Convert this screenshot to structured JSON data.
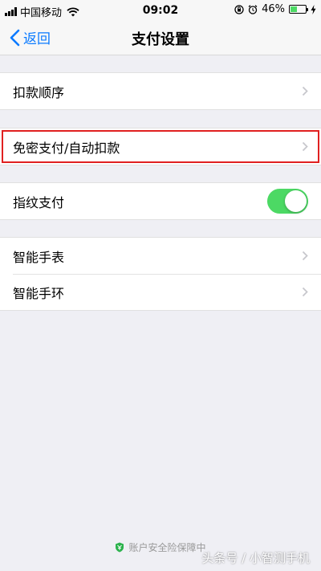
{
  "status_bar": {
    "carrier": "中国移动",
    "time": "09:02",
    "battery_percent_label": "46%",
    "battery_level": 0.46,
    "icons": [
      "signal-icon",
      "wifi-icon",
      "rotation-lock-icon",
      "alarm-icon",
      "battery-icon",
      "charging-icon"
    ]
  },
  "nav": {
    "back_label": "返回",
    "title": "支付设置"
  },
  "groups": [
    {
      "items": [
        {
          "label": "扣款顺序",
          "accessory": "chevron"
        }
      ]
    },
    {
      "items": [
        {
          "label": "免密支付/自动扣款",
          "accessory": "chevron",
          "highlighted": true
        }
      ]
    },
    {
      "items": [
        {
          "label": "指纹支付",
          "accessory": "toggle",
          "toggle_on": true
        }
      ]
    },
    {
      "items": [
        {
          "label": "智能手表",
          "accessory": "chevron"
        },
        {
          "label": "智能手环",
          "accessory": "chevron"
        }
      ]
    }
  ],
  "footer": {
    "text": "账户安全险保障中"
  },
  "watermark": {
    "text": "头条号 / 小智测手机"
  },
  "colors": {
    "accent": "#0a7aff",
    "toggle_on": "#4cd964",
    "highlight_border": "#e02020",
    "background": "#efeff4"
  }
}
